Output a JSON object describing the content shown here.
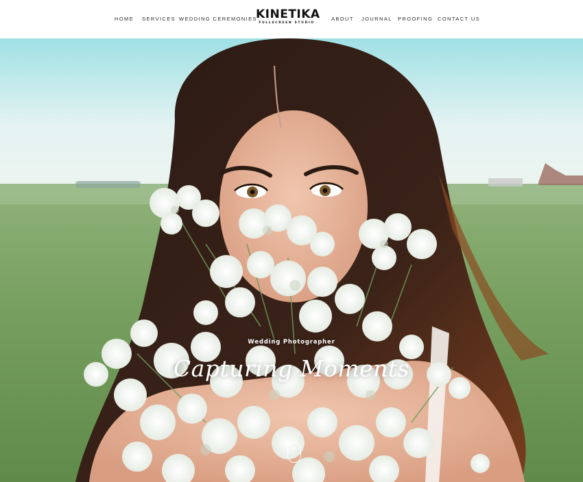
{
  "header": {
    "nav_left": [
      "Home",
      "Services",
      "Wedding Ceremonies"
    ],
    "logo_title": "KINETIKA",
    "logo_subtitle": "Fullscreen Studio",
    "nav_right": [
      "About",
      "Journal",
      "Proofing",
      "Contact Us"
    ]
  },
  "hero": {
    "subtitle": "Wedding Photographer",
    "title": "Capturing Moments",
    "scroll_icon": "mouse-scroll-icon"
  }
}
